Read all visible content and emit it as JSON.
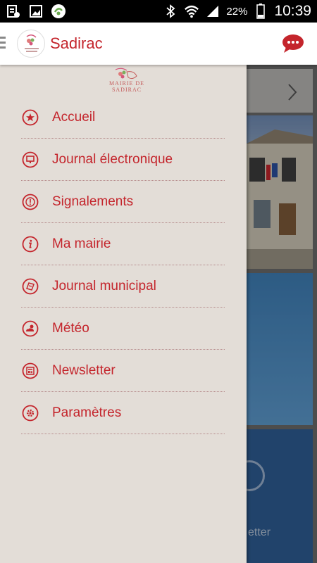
{
  "status_bar": {
    "battery_percent": "22%",
    "time": "10:39",
    "icons": [
      "sim-icon",
      "image-icon",
      "app-notification-icon",
      "bluetooth-icon",
      "wifi-icon",
      "signal-icon",
      "battery-icon"
    ]
  },
  "app_bar": {
    "title": "Sadirac",
    "icons": [
      "menu-icon",
      "logo",
      "chat-icon"
    ]
  },
  "drawer": {
    "logo_text_line1": "MAIRIE DE",
    "logo_text_line2": "SADIRAC",
    "items": [
      {
        "label": "Accueil",
        "icon": "star-icon"
      },
      {
        "label": "Journal électronique",
        "icon": "screen-icon"
      },
      {
        "label": "Signalements",
        "icon": "alert-icon"
      },
      {
        "label": "Ma mairie",
        "icon": "info-icon"
      },
      {
        "label": "Journal municipal",
        "icon": "newspaper-icon"
      },
      {
        "label": "Météo",
        "icon": "weather-icon"
      },
      {
        "label": "Newsletter",
        "icon": "newsletter-icon"
      },
      {
        "label": "Paramètres",
        "icon": "settings-icon"
      }
    ]
  },
  "background": {
    "partial_text": "etter"
  },
  "colors": {
    "accent": "#c4252c",
    "drawer_bg": "#e3ddd7",
    "appbar_bg": "#ffffff"
  }
}
